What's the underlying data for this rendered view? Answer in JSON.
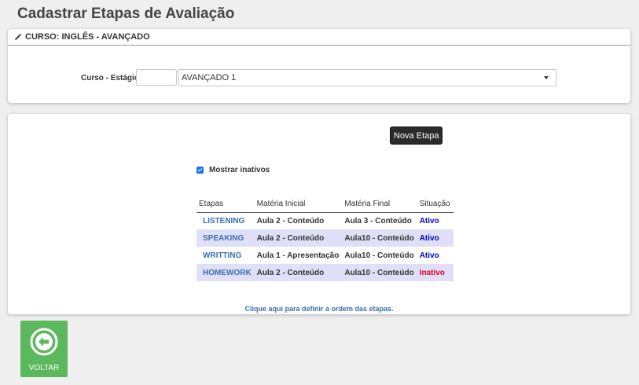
{
  "page": {
    "title": "Cadastrar Etapas de Avaliação"
  },
  "course_panel": {
    "header": "CURSO: INGLÊS - AVANÇADO",
    "field_label": "Curso - Estágio",
    "code_value": "",
    "select_value": "AVANÇADO 1"
  },
  "stages_panel": {
    "new_button": "Nova Etapa",
    "show_inactive_label": "Mostrar inativos",
    "show_inactive_checked": true,
    "columns": [
      "Etapas",
      "Matéria Inicial",
      "Matéria Final",
      "Situação"
    ],
    "rows": [
      {
        "etapa": "LISTENING",
        "inicial": "Aula 2 - Conteúdo",
        "final": "Aula 3 - Conteúdo",
        "situacao": "Ativo"
      },
      {
        "etapa": "SPEAKING",
        "inicial": "Aula 2 - Conteúdo",
        "final": "Aula10 - Conteúdo",
        "situacao": "Ativo"
      },
      {
        "etapa": "WRITTING",
        "inicial": "Aula 1 - Apresentação",
        "final": "Aula10 - Conteúdo",
        "situacao": "Ativo"
      },
      {
        "etapa": "HOMEWORK",
        "inicial": "Aula 2 - Conteúdo",
        "final": "Aula10 - Conteúdo",
        "situacao": "Inativo"
      }
    ],
    "order_link": "Clique aqui para definir a ordem das etapas."
  },
  "back_button": {
    "label": "VOLTAR",
    "icon": "arrow-left-circle-icon"
  },
  "colors": {
    "active": "#0000c8",
    "inactive": "#e0002a",
    "link": "#3a6fb0",
    "back_button": "#5cb85c",
    "row_alt": "#dfe0f7"
  }
}
